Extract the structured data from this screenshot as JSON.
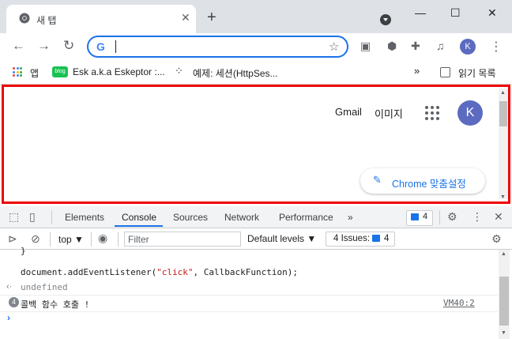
{
  "browser": {
    "tab_title": "새 탭",
    "close_glyph": "✕",
    "newtab_glyph": "+",
    "window_controls": [
      "—",
      "☐",
      "✕"
    ],
    "omnibox_value": "",
    "profile_initial": "K"
  },
  "bookmarks": {
    "apps_label": "앱",
    "blog_badge": "blog",
    "item1": "Esk a.k.a Eskeptor :...",
    "item2": "예제: 세션(HttpSes...",
    "overflow": "»",
    "reading_list": "읽기 목록"
  },
  "newtab_page": {
    "gmail": "Gmail",
    "images": "이미지",
    "avatar_initial": "K",
    "customize_label": "Chrome 맞춤설정"
  },
  "devtools": {
    "tabs": [
      "Elements",
      "Console",
      "Sources",
      "Network",
      "Performance"
    ],
    "more_tabs": "»",
    "message_count": "4",
    "context": "top ▼",
    "filter_placeholder": "Filter",
    "levels": "Default levels ▼",
    "issues_label": "4 Issues:",
    "issues_count": "4"
  },
  "console": {
    "brace": "}",
    "code_prefix": "document.addEventListener(",
    "code_string": "\"click\"",
    "code_suffix": ", CallbackFunction);",
    "return_value": "undefined",
    "log_repeat": "4",
    "log_message": "콜백 함수 호출 !",
    "log_source": "VM40:2",
    "prompt": "›"
  }
}
